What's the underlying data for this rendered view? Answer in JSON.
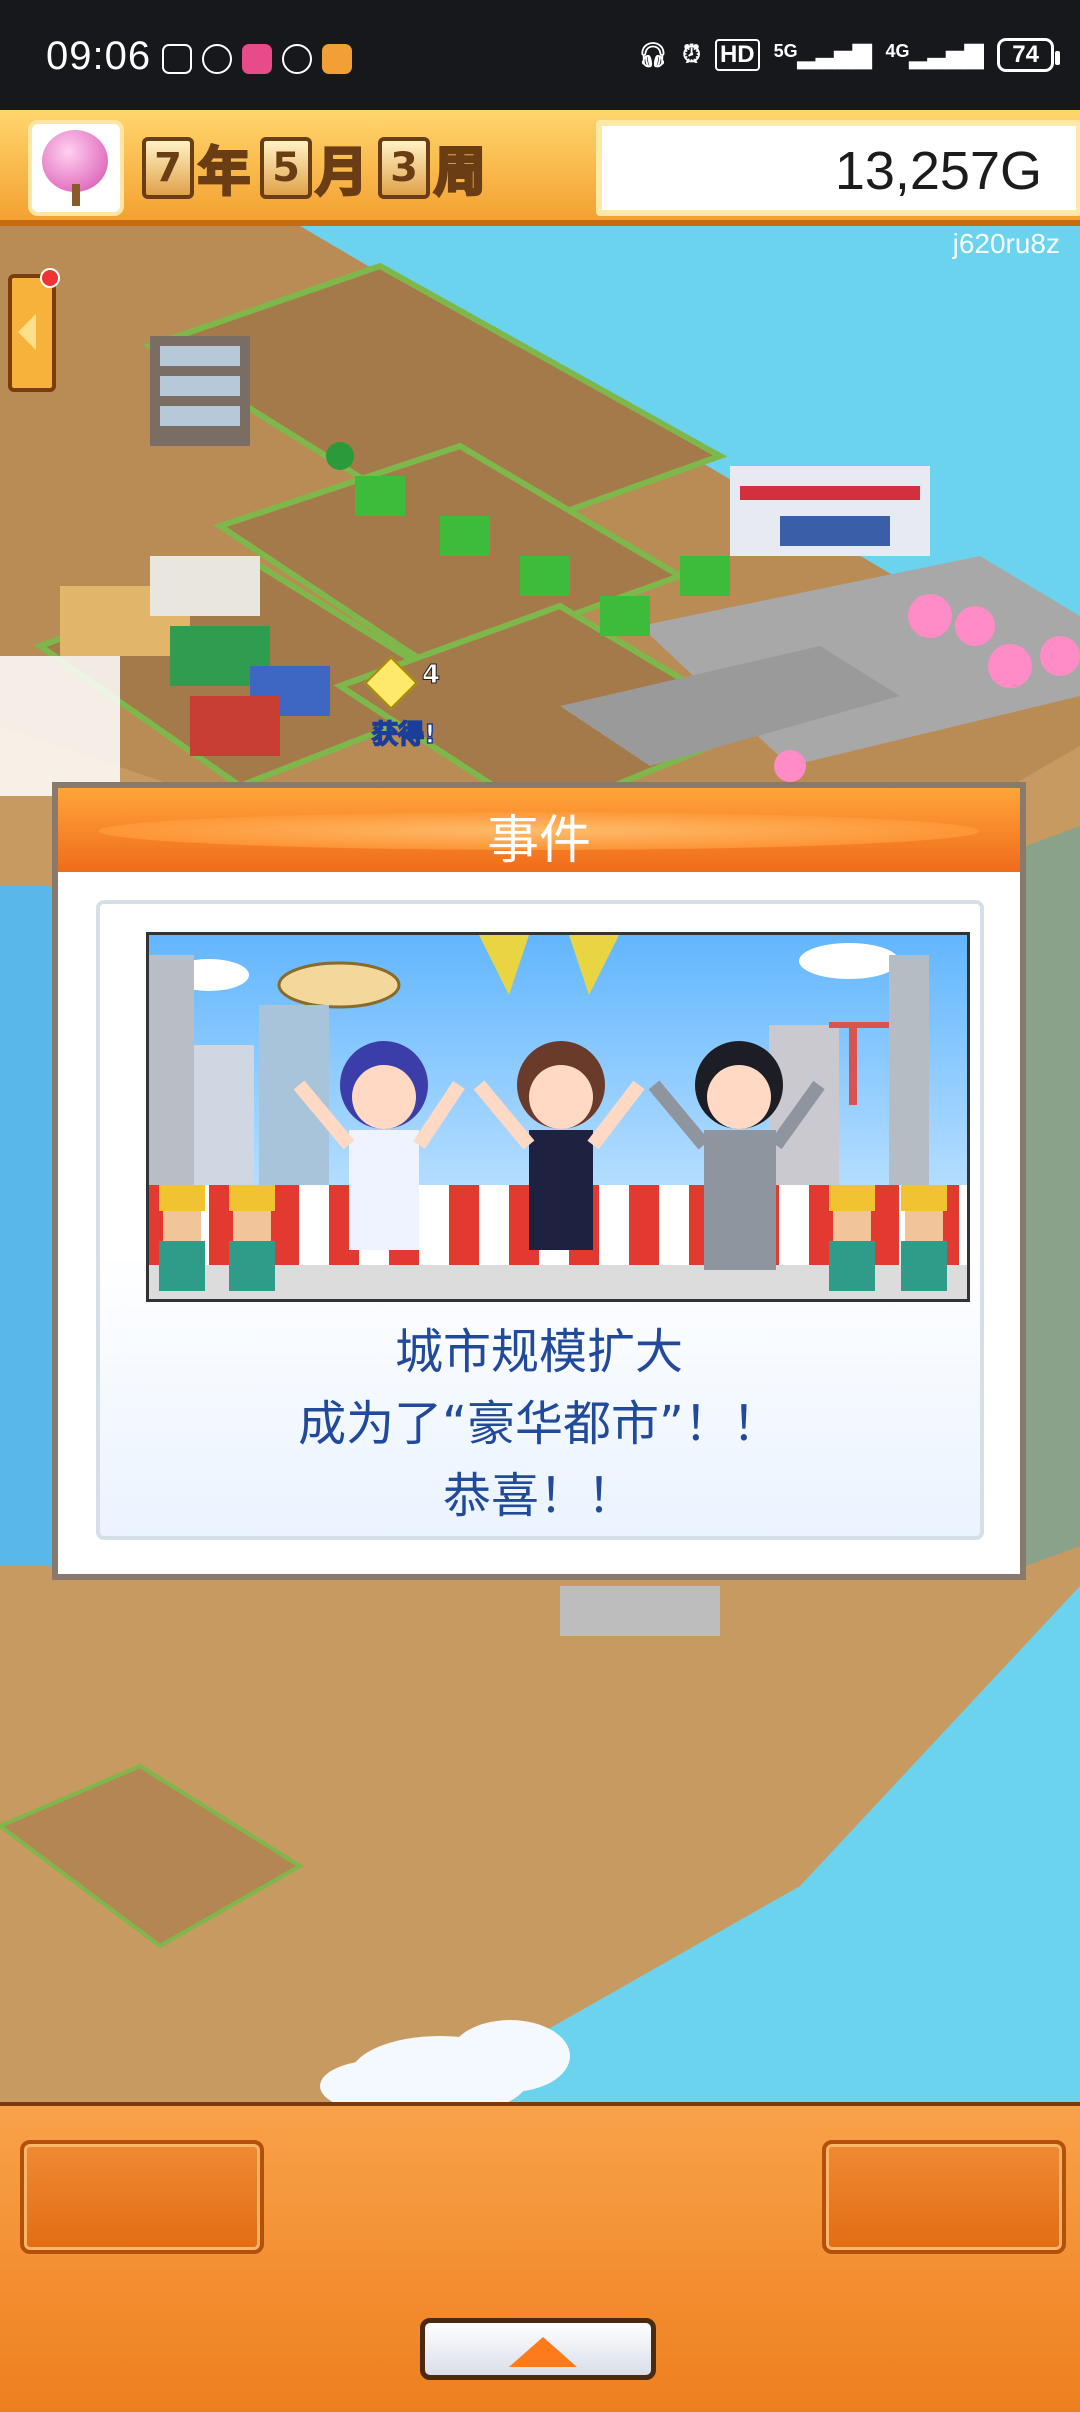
{
  "status_bar": {
    "time": "09:06",
    "right": [
      "HD",
      "5G",
      "4G"
    ],
    "battery": "74"
  },
  "hud": {
    "date": [
      {
        "num": "7",
        "unit": "年"
      },
      {
        "num": "5",
        "unit": "月"
      },
      {
        "num": "3",
        "unit": "周"
      }
    ],
    "money": "13,257G",
    "watermark": "j620ru8z"
  },
  "event_dialog": {
    "title": "事件",
    "message_lines": [
      "城市规模扩大",
      "成为了“豪华都市”！！",
      "恭喜！！"
    ]
  },
  "world_badge": {
    "count": "4",
    "label": "获得!"
  },
  "colors": {
    "status_bar": "#16181c",
    "hud_orange": "#f4a131",
    "dialog_title": "#f06b1a",
    "message_text": "#224a9a",
    "water": "#6bd3ee",
    "bottom_panel": "#ee7f1e"
  }
}
